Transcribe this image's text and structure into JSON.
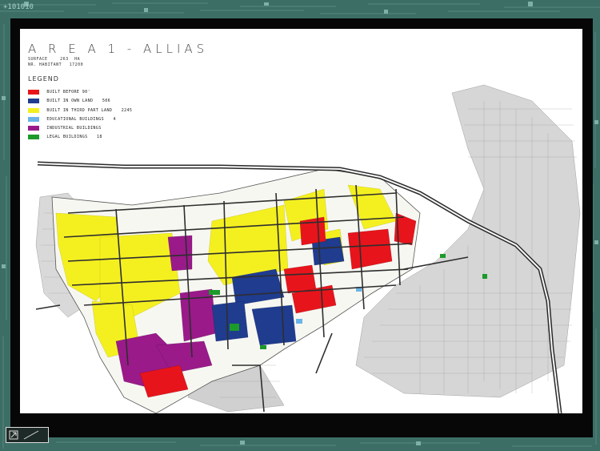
{
  "title": "A R E A  1 - ALLIAS",
  "stats": [
    {
      "label": "SURFACE",
      "value": "263",
      "unit": "HA"
    },
    {
      "label": "NR. HABITANT",
      "value": "17200",
      "unit": ""
    }
  ],
  "legend": {
    "title": "LEGEND",
    "items": [
      {
        "label": "BUILT BEFORE 90'",
        "count": "",
        "color": "#e8141b"
      },
      {
        "label": "BUILT IN OWN LAND",
        "count": "506",
        "color": "#1f3c8f"
      },
      {
        "label": "BUILT IN THIRD PART LAND",
        "count": "2245",
        "color": "#f4f020"
      },
      {
        "label": "EDUCATIONAL BUILDINGS",
        "count": "4",
        "color": "#6ab4e8"
      },
      {
        "label": "INDUSTRIAL BUILDINGS",
        "count": "",
        "color": "#9a1a8a"
      },
      {
        "label": "LEGAL BUILDINGS",
        "count": "18",
        "color": "#1c9a2a"
      }
    ]
  },
  "colors": {
    "background": "#3d6e66",
    "frame": "#070707",
    "sheet": "#ffffff",
    "road": "#3a3a3a"
  },
  "nav": {
    "icon": "navigation-arrow-icon"
  }
}
